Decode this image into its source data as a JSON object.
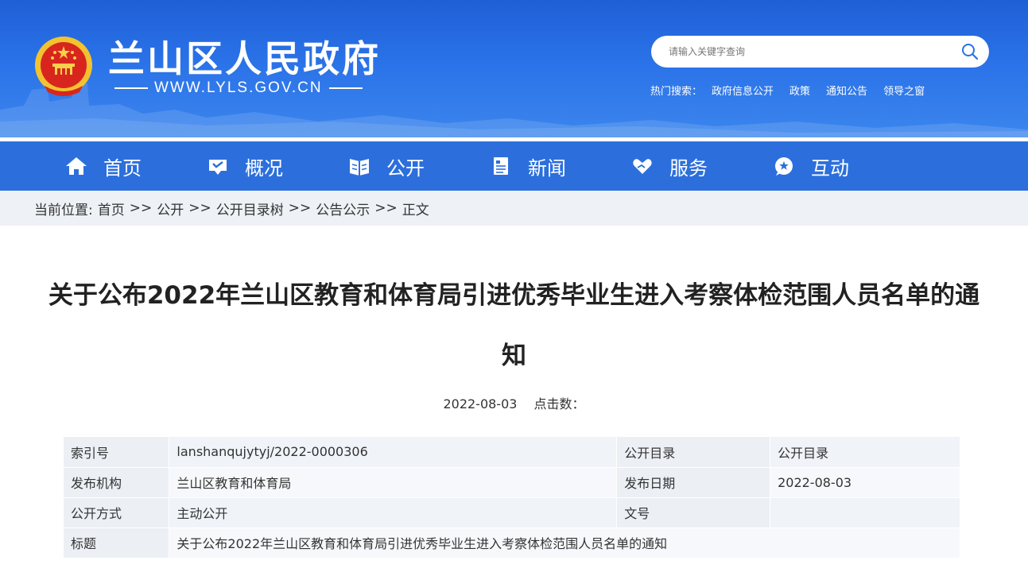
{
  "header": {
    "site_name": "兰山区人民政府",
    "site_url": "WWW.LYLS.GOV.CN",
    "search": {
      "placeholder": "请输入关键字查询"
    },
    "hot_search": {
      "label": "热门搜索：",
      "items": [
        "政府信息公开",
        "政策",
        "通知公告",
        "领导之窗"
      ]
    }
  },
  "nav": {
    "items": [
      {
        "label": "首页",
        "icon": "home-icon"
      },
      {
        "label": "概况",
        "icon": "overview-icon"
      },
      {
        "label": "公开",
        "icon": "book-icon"
      },
      {
        "label": "新闻",
        "icon": "news-icon"
      },
      {
        "label": "服务",
        "icon": "heart-hand-icon"
      },
      {
        "label": "互动",
        "icon": "chat-star-icon"
      }
    ]
  },
  "breadcrumb": {
    "prefix": "当前位置:",
    "items": [
      "首页",
      "公开",
      "公开目录树",
      "公告公示",
      "正文"
    ],
    "separator": ">>"
  },
  "article": {
    "title": "关于公布2022年兰山区教育和体育局引进优秀毕业生进入考察体检范围人员名单的通知",
    "date": "2022-08-03",
    "clicks_label": "点击数："
  },
  "info": {
    "index_label": "索引号",
    "index_value": "lanshanqujytyj/2022-0000306",
    "catalog_label": "公开目录",
    "catalog_value": "公开目录",
    "org_label": "发布机构",
    "org_value": "兰山区教育和体育局",
    "pubdate_label": "发布日期",
    "pubdate_value": "2022-08-03",
    "method_label": "公开方式",
    "method_value": "主动公开",
    "docno_label": "文号",
    "docno_value": "",
    "title_label": "标题",
    "title_value": "关于公布2022年兰山区教育和体育局引进优秀毕业生进入考察体检范围人员名单的通知"
  },
  "colors": {
    "header_blue": "#2a72e8",
    "nav_blue": "#2c6fdc",
    "breadcrumb_bg": "#eef1f5"
  }
}
